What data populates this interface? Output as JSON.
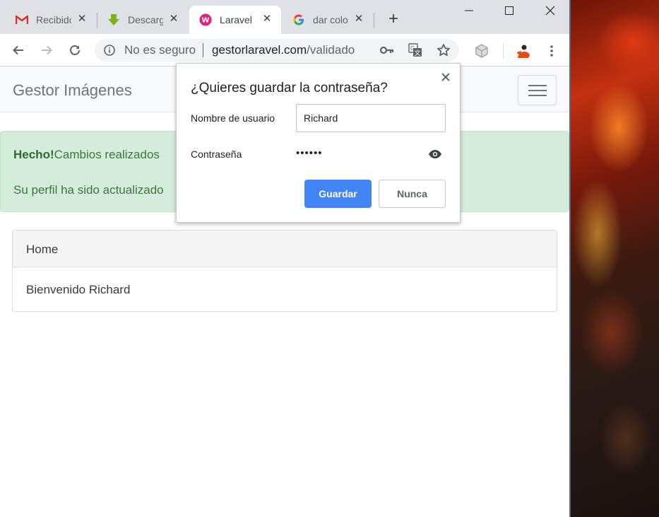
{
  "tabs": [
    {
      "title": "Recibidos",
      "icon": "gmail-icon"
    },
    {
      "title": "Descargas",
      "icon": "download-arrow-icon"
    },
    {
      "title": "Laravel",
      "icon": "wamp-icon"
    },
    {
      "title": "dar color",
      "icon": "google-icon"
    }
  ],
  "toolbar": {
    "security_text": "No es seguro",
    "url_host": "gestorlaravel.com",
    "url_path": "/validado"
  },
  "page": {
    "brand": "Gestor Imágenes",
    "alert": {
      "strong": "Hecho!",
      "text": "Cambios realizados",
      "detail": "Su perfil ha sido actualizado"
    },
    "card": {
      "header": "Home",
      "body": "Bienvenido Richard"
    }
  },
  "password_bubble": {
    "title": "¿Quieres guardar la contraseña?",
    "username_label": "Nombre de usuario",
    "username_value": "Richard",
    "password_label": "Contraseña",
    "password_masked": "••••••",
    "save_label": "Guardar",
    "never_label": "Nunca"
  },
  "colors": {
    "accent": "#4285f4",
    "alert_bg": "#d4edda",
    "tabstrip_bg": "#dee1e6"
  }
}
